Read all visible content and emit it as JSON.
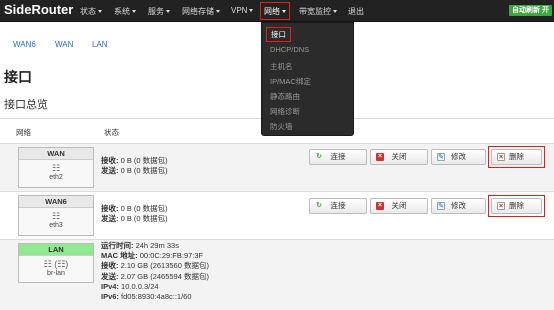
{
  "app": {
    "brand": "SideRouter",
    "auto_refresh": "自动刷新 开"
  },
  "nav": {
    "items": [
      {
        "label": "状态",
        "has_caret": true
      },
      {
        "label": "系统",
        "has_caret": true
      },
      {
        "label": "服务",
        "has_caret": true
      },
      {
        "label": "网络存储",
        "has_caret": true
      },
      {
        "label": "VPN",
        "has_caret": true
      },
      {
        "label": "网络",
        "has_caret": true,
        "active": true
      },
      {
        "label": "带宽监控",
        "has_caret": true
      },
      {
        "label": "退出",
        "has_caret": false
      }
    ]
  },
  "dropdown": {
    "items": [
      "接口",
      "DHCP/DNS",
      "主机名",
      "IP/MAC绑定",
      "静态路由",
      "网络诊断",
      "防火墙"
    ]
  },
  "tabs": [
    "WAN6",
    "WAN",
    "LAN"
  ],
  "page": {
    "title": "接口",
    "section": "接口总览"
  },
  "table": {
    "headers": [
      "网络",
      "状态"
    ],
    "rows": [
      {
        "name": "WAN",
        "icon": "ethernet-port-icon",
        "device": "eth2",
        "status": [
          {
            "label": "接收:",
            "value": "0 B (0 数据包)"
          },
          {
            "label": "发送:",
            "value": "0 B (0 数据包)"
          }
        ]
      },
      {
        "name": "WAN6",
        "icon": "ethernet-port-icon",
        "device": "eth3",
        "status": [
          {
            "label": "接收:",
            "value": "0 B (0 数据包)"
          },
          {
            "label": "发送:",
            "value": "0 B (0 数据包)"
          }
        ]
      },
      {
        "name": "LAN",
        "icon": "bridge-icon",
        "device": "br-lan",
        "status": [
          {
            "label": "运行时间:",
            "value": "24h 29m 33s"
          },
          {
            "label": "MAC 地址:",
            "value": "00:0C:29:FB:97:3F"
          },
          {
            "label": "接收:",
            "value": "2.10 GB (2613560 数据包)"
          },
          {
            "label": "发送:",
            "value": "2.07 GB (2465594 数据包)"
          },
          {
            "label": "IPv4:",
            "value": "10.0.0.3/24"
          },
          {
            "label": "IPv6:",
            "value": "fd05:8930:4a8c::1/60"
          }
        ]
      }
    ],
    "buttons": {
      "connect": "连接",
      "close": "关闭",
      "edit": "修改",
      "delete": "删除"
    }
  },
  "icons": {
    "connect": "refresh-icon",
    "close": "close-circle-icon",
    "edit": "edit-icon",
    "delete": "delete-icon"
  },
  "colors": {
    "navbar": "#222222",
    "highlight": "#e02020",
    "link": "#2a6dbf",
    "lan_green": "#90e890",
    "refresh_badge": "#3fa63f"
  }
}
